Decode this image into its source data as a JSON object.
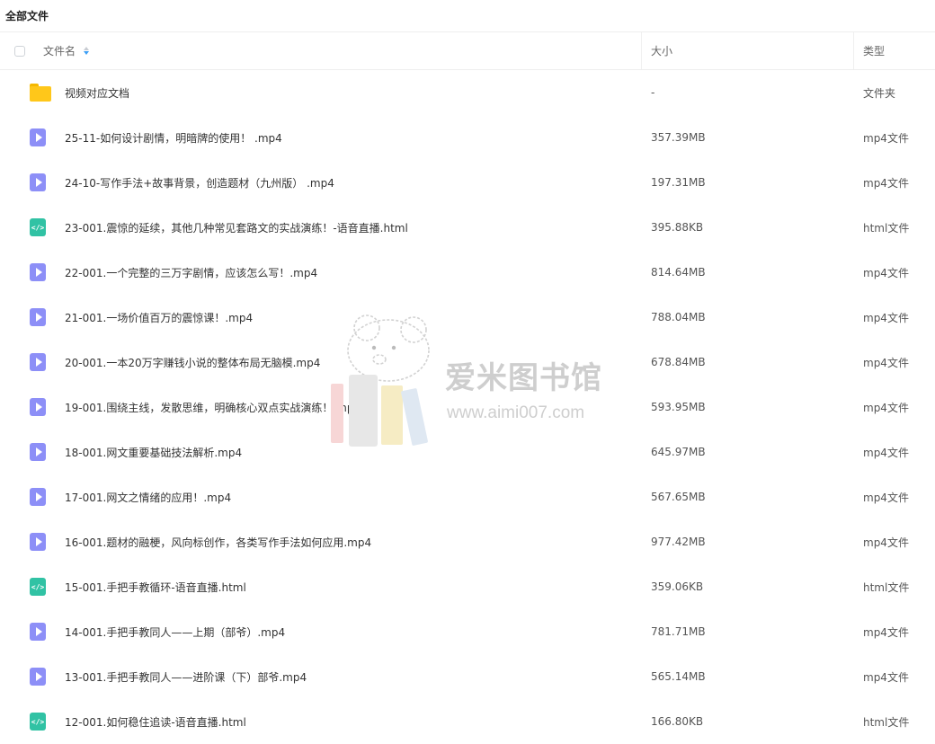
{
  "breadcrumb": {
    "title": "全部文件"
  },
  "table": {
    "columns": {
      "name": "文件名",
      "size": "大小",
      "type": "类型"
    },
    "rows": [
      {
        "icon": "folder-icon",
        "name": "视频对应文档",
        "size": "-",
        "type": "文件夹"
      },
      {
        "icon": "video-file-icon",
        "name": "25-11-如何设计剧情，明暗牌的使用！ .mp4",
        "size": "357.39MB",
        "type": "mp4文件"
      },
      {
        "icon": "video-file-icon",
        "name": "24-10-写作手法+故事背景，创造题材（九州版） .mp4",
        "size": "197.31MB",
        "type": "mp4文件"
      },
      {
        "icon": "html-file-icon",
        "name": "23-001.震惊的延续，其他几种常见套路文的实战演练！-语音直播.html",
        "size": "395.88KB",
        "type": "html文件"
      },
      {
        "icon": "video-file-icon",
        "name": "22-001.一个完整的三万字剧情，应该怎么写！.mp4",
        "size": "814.64MB",
        "type": "mp4文件"
      },
      {
        "icon": "video-file-icon",
        "name": "21-001.一场价值百万的震惊课！.mp4",
        "size": "788.04MB",
        "type": "mp4文件"
      },
      {
        "icon": "video-file-icon",
        "name": "20-001.一本20万字赚钱小说的整体布局无脑模.mp4",
        "size": "678.84MB",
        "type": "mp4文件"
      },
      {
        "icon": "video-file-icon",
        "name": "19-001.围绕主线，发散思维，明确核心双点实战演练！.mp4",
        "size": "593.95MB",
        "type": "mp4文件"
      },
      {
        "icon": "video-file-icon",
        "name": "18-001.网文重要基础技法解析.mp4",
        "size": "645.97MB",
        "type": "mp4文件"
      },
      {
        "icon": "video-file-icon",
        "name": "17-001.网文之情绪的应用！.mp4",
        "size": "567.65MB",
        "type": "mp4文件"
      },
      {
        "icon": "video-file-icon",
        "name": "16-001.题材的融梗，风向标创作，各类写作手法如何应用.mp4",
        "size": "977.42MB",
        "type": "mp4文件"
      },
      {
        "icon": "html-file-icon",
        "name": "15-001.手把手教循环-语音直播.html",
        "size": "359.06KB",
        "type": "html文件"
      },
      {
        "icon": "video-file-icon",
        "name": "14-001.手把手教同人——上期（部爷）.mp4",
        "size": "781.71MB",
        "type": "mp4文件"
      },
      {
        "icon": "video-file-icon",
        "name": "13-001.手把手教同人——进阶课（下）部爷.mp4",
        "size": "565.14MB",
        "type": "mp4文件"
      },
      {
        "icon": "html-file-icon",
        "name": "12-001.如何稳住追读-语音直播.html",
        "size": "166.80KB",
        "type": "html文件"
      }
    ]
  },
  "watermark": {
    "title": "爱米图书馆",
    "url": "www.aimi007.com"
  },
  "colors": {
    "accent": "#3b9ef5",
    "folder": "#ffc71a",
    "video": "#8d8ff7",
    "html": "#31c2a4"
  }
}
